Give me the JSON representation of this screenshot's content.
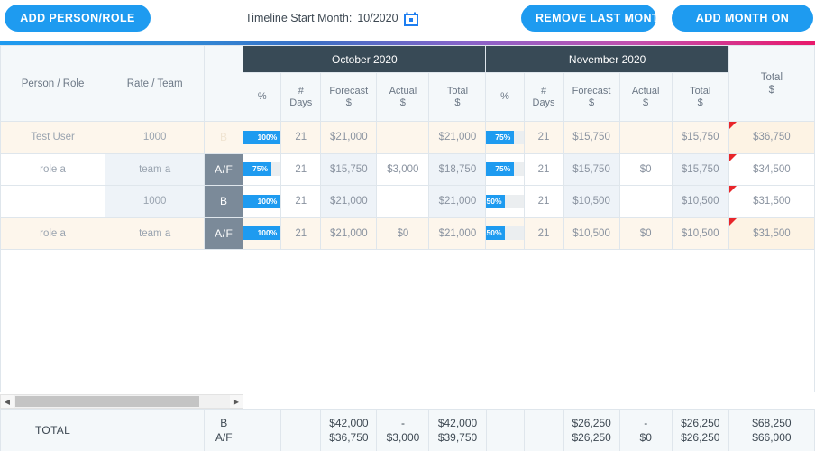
{
  "toolbar": {
    "add_person_label": "ADD PERSON/ROLE",
    "timeline_label": "Timeline Start Month:",
    "timeline_value": "10/2020",
    "calendar_icon": "calendar-icon",
    "remove_last_month_label": "REMOVE LAST MONTH",
    "add_month_label": "ADD MONTH ON",
    "accent_color": "#1e9bf0"
  },
  "gradient": {
    "from": "#1e9bf0",
    "to": "#e8196b"
  },
  "table": {
    "headers": {
      "person_role": "Person / Role",
      "rate_team": "Rate / Team",
      "af": "",
      "total_right_line1": "Total",
      "total_right_line2": "$"
    },
    "months": [
      {
        "title": "October 2020"
      },
      {
        "title": "November 2020"
      }
    ],
    "sub_headers": [
      {
        "line1": "%",
        "line2": ""
      },
      {
        "line1": "#",
        "line2": "Days"
      },
      {
        "line1": "Forecast",
        "line2": "$"
      },
      {
        "line1": "Actual",
        "line2": "$"
      },
      {
        "line1": "Total",
        "line2": "$"
      }
    ],
    "rows": [
      {
        "person": "Test User",
        "rate": "1000",
        "af": "B",
        "af_faint": true,
        "row_tone": "cream",
        "oct": {
          "pct": "100%",
          "pct_value": 100,
          "days": "21",
          "forecast": "$21,000",
          "actual": "",
          "total": "$21,000"
        },
        "nov": {
          "pct": "75%",
          "pct_value": 75,
          "days": "21",
          "forecast": "$15,750",
          "actual": "",
          "total": "$15,750"
        },
        "grand_total": "$36,750",
        "has_comment": true
      },
      {
        "person": "role a",
        "rate": "team a",
        "af": "A/F",
        "af_faint": false,
        "row_tone": "white",
        "oct": {
          "pct": "75%",
          "pct_value": 75,
          "days": "21",
          "forecast": "$15,750",
          "actual": "$3,000",
          "total": "$18,750"
        },
        "nov": {
          "pct": "75%",
          "pct_value": 75,
          "days": "21",
          "forecast": "$15,750",
          "actual": "$0",
          "total": "$15,750"
        },
        "grand_total": "$34,500",
        "has_comment": true
      },
      {
        "person": "",
        "rate": "1000",
        "af": "B",
        "af_faint": false,
        "row_tone": "white",
        "oct": {
          "pct": "100%",
          "pct_value": 100,
          "days": "21",
          "forecast": "$21,000",
          "actual": "",
          "total": "$21,000"
        },
        "nov": {
          "pct": "50%",
          "pct_value": 50,
          "days": "21",
          "forecast": "$10,500",
          "actual": "",
          "total": "$10,500"
        },
        "grand_total": "$31,500",
        "has_comment": true
      },
      {
        "person": "role a",
        "rate": "team a",
        "af": "A/F",
        "af_faint": false,
        "row_tone": "cream",
        "oct": {
          "pct": "100%",
          "pct_value": 100,
          "days": "21",
          "forecast": "$21,000",
          "actual": "$0",
          "total": "$21,000"
        },
        "nov": {
          "pct": "50%",
          "pct_value": 50,
          "days": "21",
          "forecast": "$10,500",
          "actual": "$0",
          "total": "$10,500"
        },
        "grand_total": "$31,500",
        "has_comment": true
      }
    ]
  },
  "scrollbar": {
    "left_arrow": "◀",
    "right_arrow": "▶"
  },
  "footer": {
    "label": "TOTAL",
    "rate_team": "",
    "af_line1": "B",
    "af_line2": "A/F",
    "oct": {
      "pct": "",
      "days": "",
      "forecast_b": "$42,000",
      "forecast_af": "$36,750",
      "actual_b": "-",
      "actual_af": "$3,000",
      "total_b": "$42,000",
      "total_af": "$39,750"
    },
    "nov": {
      "pct": "",
      "days": "",
      "forecast_b": "$26,250",
      "forecast_af": "$26,250",
      "actual_b": "-",
      "actual_af": "$0",
      "total_b": "$26,250",
      "total_af": "$26,250"
    },
    "grand_b": "$68,250",
    "grand_af": "$66,000"
  }
}
